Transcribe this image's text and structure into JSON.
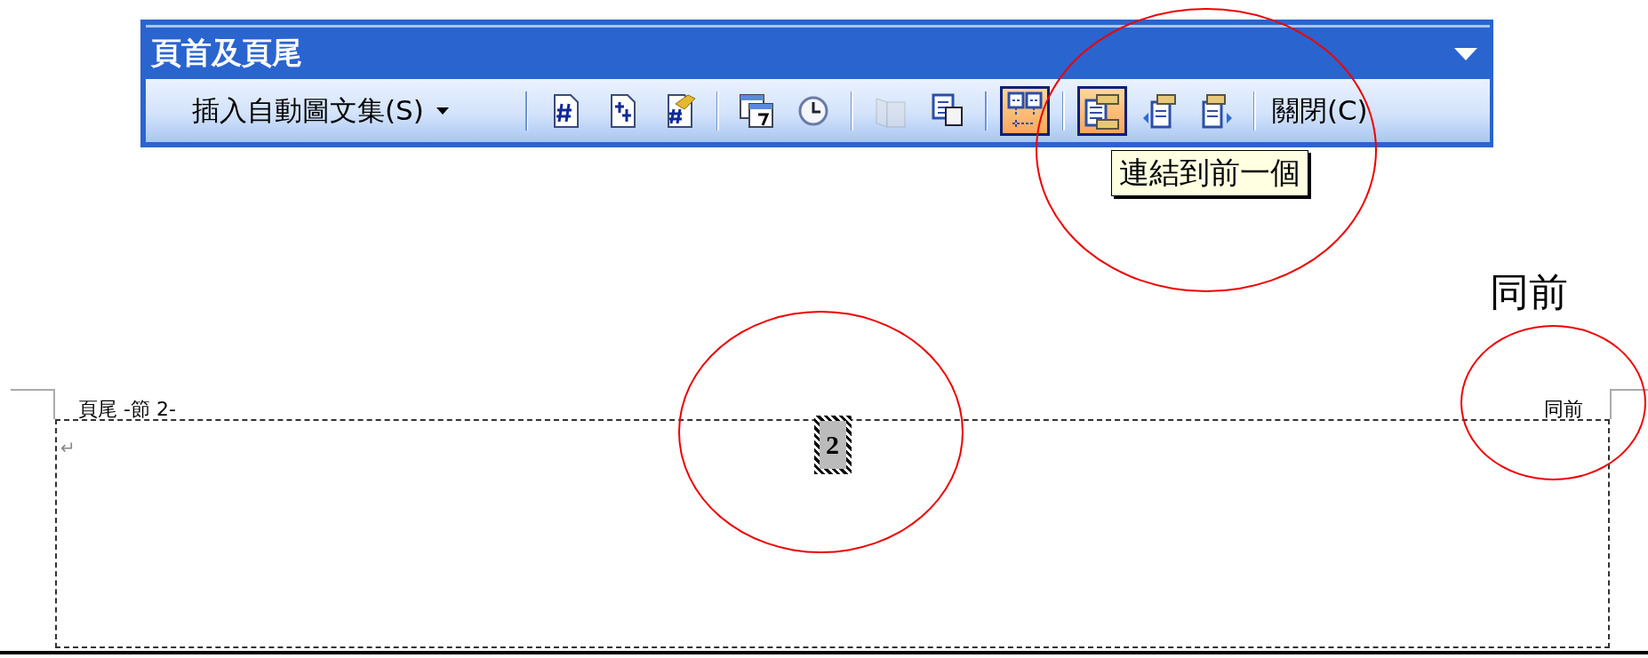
{
  "toolbar": {
    "title": "頁首及頁尾",
    "items": [
      {
        "kind": "dropdown",
        "label": "插入自動圖文集(S)"
      },
      {
        "kind": "separator"
      },
      {
        "kind": "button",
        "selected": false,
        "disabled": false
      },
      {
        "kind": "button",
        "selected": false,
        "disabled": false
      },
      {
        "kind": "button",
        "selected": false,
        "disabled": false
      },
      {
        "kind": "separator"
      },
      {
        "kind": "button",
        "selected": false,
        "disabled": false
      },
      {
        "kind": "button",
        "selected": false,
        "disabled": false
      },
      {
        "kind": "separator"
      },
      {
        "kind": "button",
        "selected": false,
        "disabled": true
      },
      {
        "kind": "button",
        "selected": false,
        "disabled": false
      },
      {
        "kind": "separator"
      },
      {
        "kind": "button",
        "selected": true,
        "disabled": false
      },
      {
        "kind": "separator"
      },
      {
        "kind": "button",
        "selected": true,
        "disabled": false
      },
      {
        "kind": "button",
        "selected": false,
        "disabled": false
      },
      {
        "kind": "button",
        "selected": false,
        "disabled": false
      },
      {
        "kind": "separator"
      },
      {
        "kind": "text",
        "label": "關閉(C)"
      }
    ]
  },
  "tooltip": "連結到前一個",
  "footer": {
    "label": "頁尾 -節 2-",
    "same_as_previous": "同前",
    "paragraph_mark": "↵",
    "page_number": "2"
  },
  "annotation": {
    "note": "同前"
  }
}
